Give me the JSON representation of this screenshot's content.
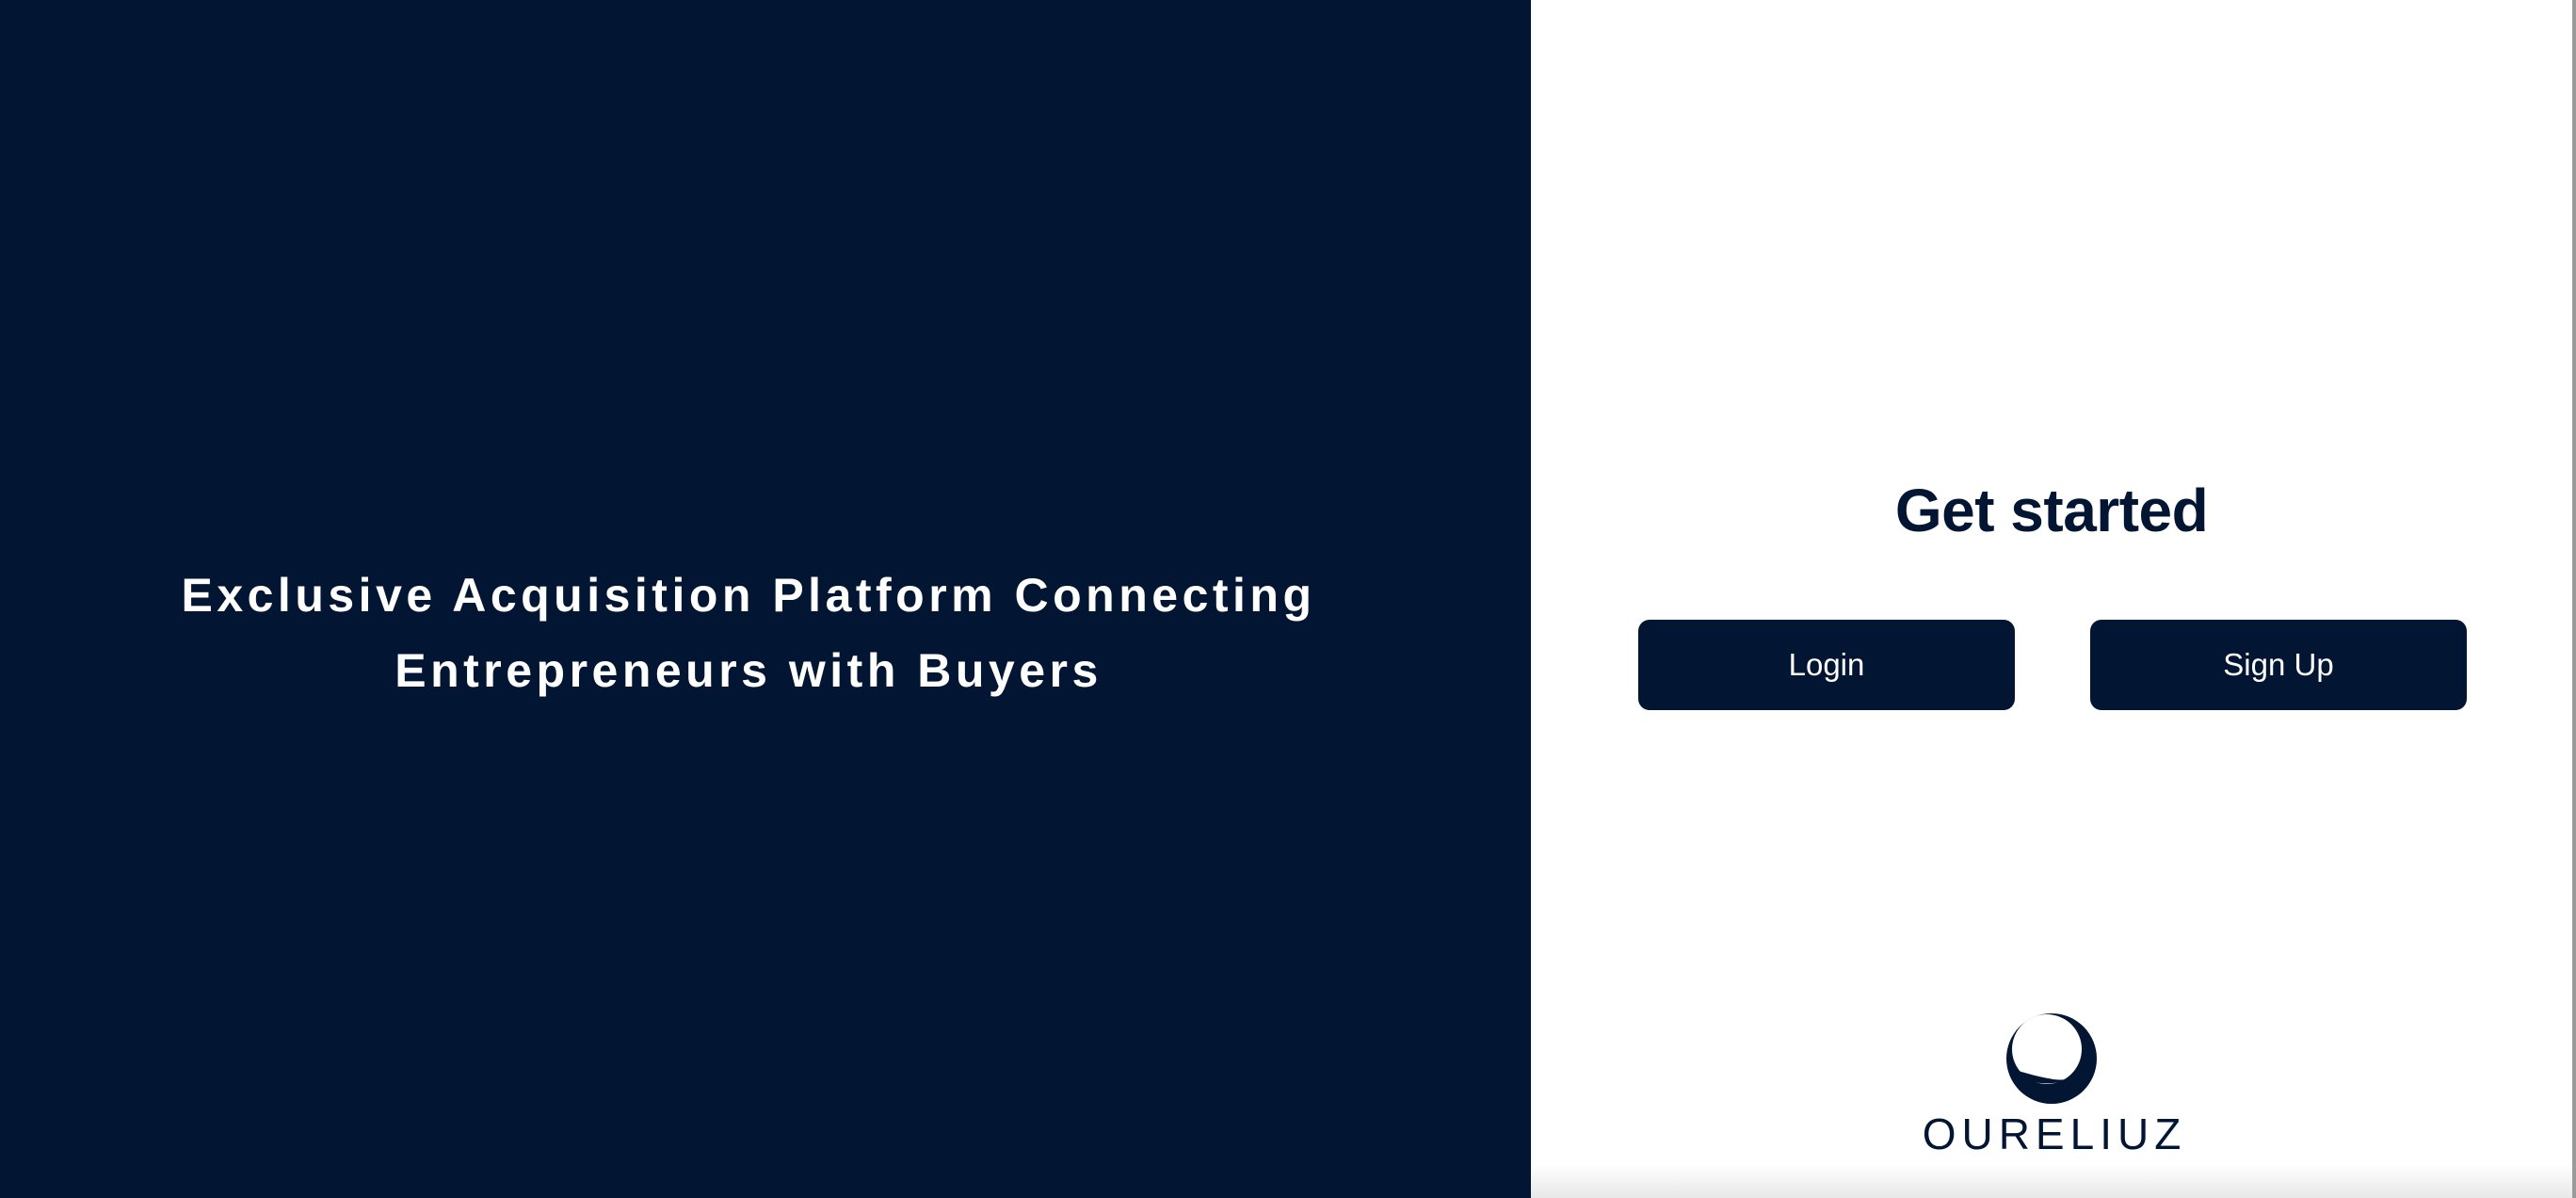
{
  "hero": {
    "tagline_line1": "Exclusive Acquisition Platform Connecting",
    "tagline_line2": "Entrepreneurs with Buyers"
  },
  "auth": {
    "heading": "Get started",
    "login_label": "Login",
    "signup_label": "Sign Up"
  },
  "brand": {
    "name": "OURELIUZ",
    "icon": "crescent-globe-icon"
  },
  "colors": {
    "navy": "#021634",
    "white": "#ffffff"
  }
}
